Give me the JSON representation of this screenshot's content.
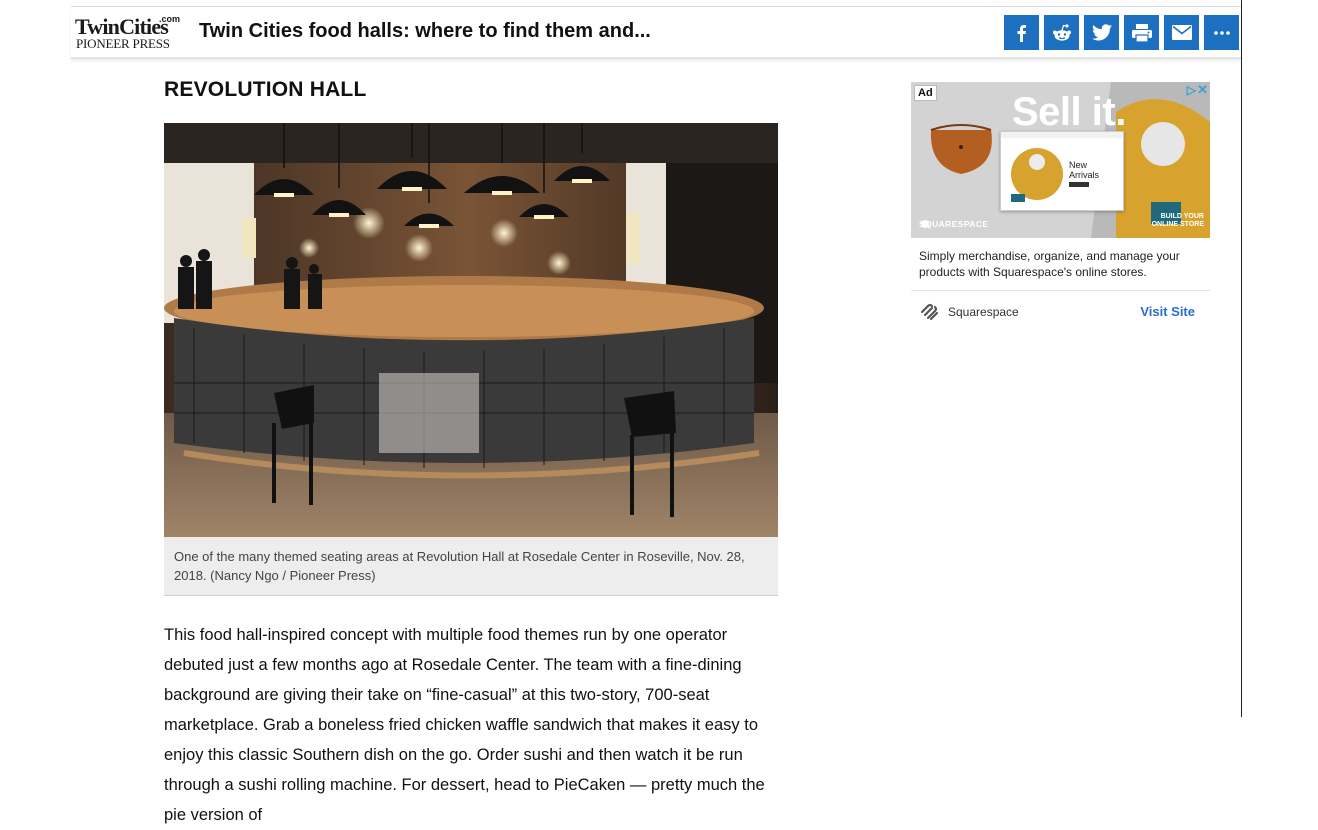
{
  "header": {
    "logo_line1": "TwinCities",
    "logo_com": ".com",
    "logo_line2": "PIONEER PRESS",
    "title": "Twin Cities food halls: where to find them and...",
    "share_buttons": [
      "facebook-icon",
      "reddit-icon",
      "twitter-icon",
      "print-icon",
      "email-icon",
      "more-icon"
    ],
    "share_color": "#1d6fc0"
  },
  "article": {
    "section_title": "REVOLUTION HALL",
    "photo_caption": "One of the many themed seating areas at Revolution Hall at Rosedale Center in Roseville, Nov. 28, 2018. (Nancy Ngo / Pioneer Press)",
    "paragraph": "This food hall-inspired concept with multiple food themes run by one operator debuted just a few months ago at Rosedale Center. The team with a fine-dining background are giving their take on “fine-casual” at this two-story, 700-seat marketplace. Grab a boneless fried chicken waffle sandwich that makes it easy to enjoy this classic Southern dish on the go. Order sushi and then watch it be run through a sushi rolling machine. For dessert, head to PieCaken — pretty much the pie version of"
  },
  "ad": {
    "badge": "Ad",
    "adchoices": "▷",
    "close": "✕",
    "headline": "Sell it.",
    "inner_text_line1": "New",
    "inner_text_line2": "Arrivals",
    "brand_small": "SQUARESPACE",
    "cta_small_line1": "BUILD YOUR",
    "cta_small_line2": "ONLINE STORE",
    "description": "Simply merchandise, organize, and manage your products with Squarespace's online stores.",
    "advertiser": "Squarespace",
    "cta": "Visit Site",
    "cta_color": "#2b6cd1"
  }
}
